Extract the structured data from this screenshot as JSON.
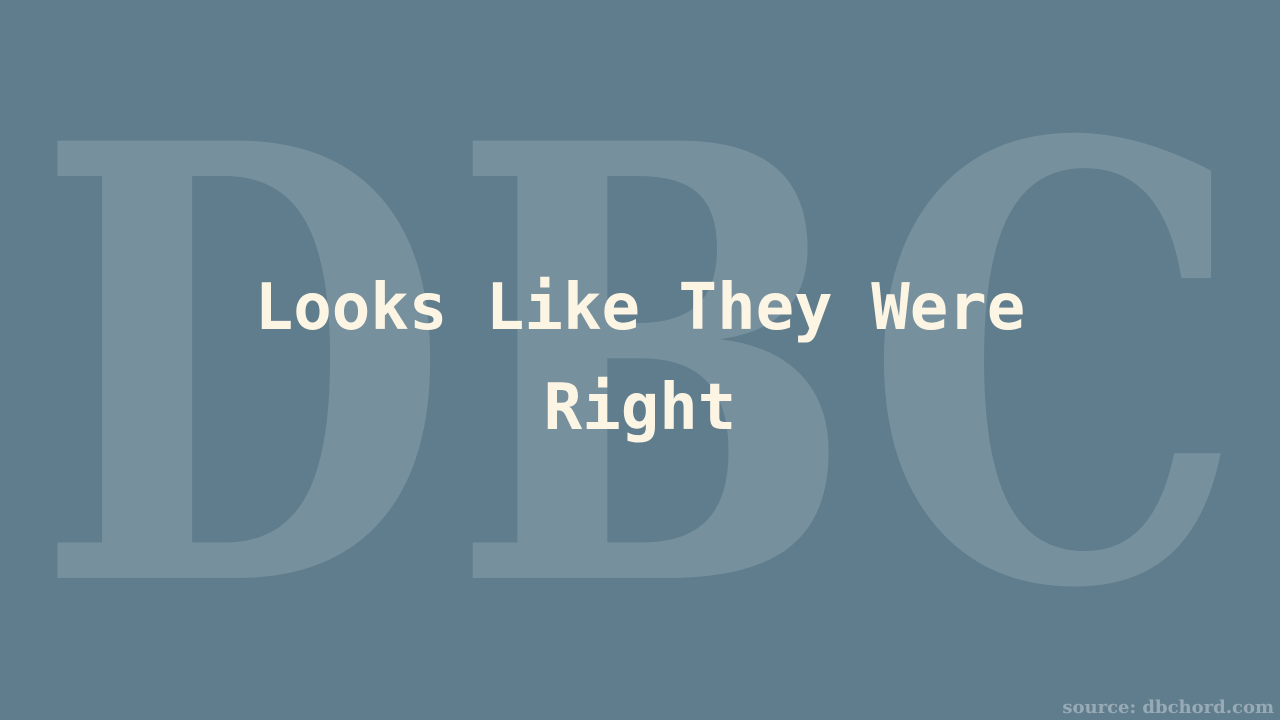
{
  "watermark": {
    "text": "DBC"
  },
  "headline": {
    "line1": "Looks Like They Were",
    "line2": "Right"
  },
  "footer": {
    "source": "source: dbchord.com"
  },
  "colors": {
    "background": "#607d8d",
    "headline_text": "#fdf5e4",
    "watermark": "#ffffff"
  }
}
